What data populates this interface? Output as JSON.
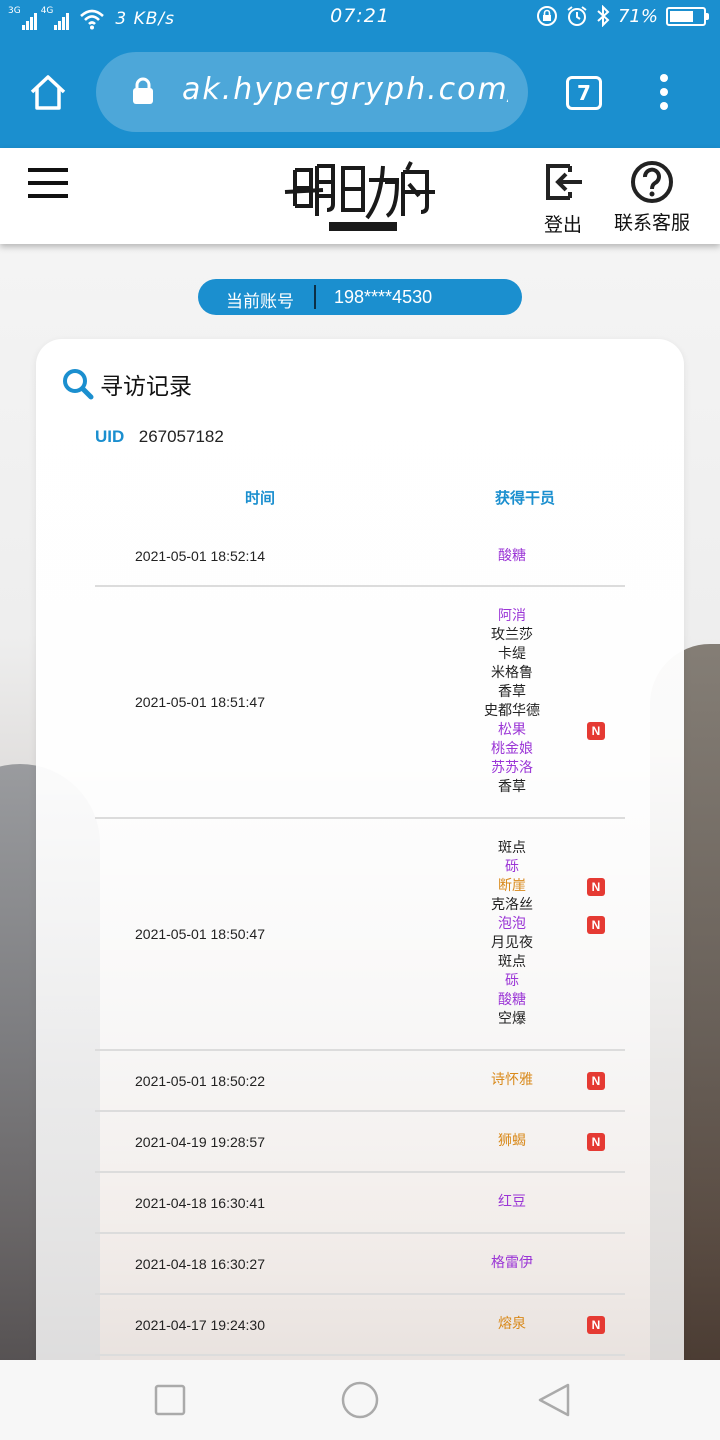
{
  "status_bar": {
    "net1": "3G",
    "net2": "4G",
    "speed": "3 KB/s",
    "time": "07:21",
    "battery": "71%",
    "battery_level": 0.71
  },
  "browser": {
    "url": "ak.hypergryph.com/us",
    "tab_count": "7"
  },
  "header": {
    "logout_label": "登出",
    "help_label": "联系客服"
  },
  "account": {
    "label": "当前账号",
    "value": "198****4530"
  },
  "card": {
    "title": "寻访记录",
    "uid_label": "UID",
    "uid_value": "267057182",
    "col_time": "时间",
    "col_operator": "获得干员",
    "new_badge": "N"
  },
  "records": [
    {
      "time": "2021-05-01 18:52:14",
      "ops": [
        {
          "name": "酸糖",
          "rarity": 4,
          "new": false
        }
      ]
    },
    {
      "time": "2021-05-01 18:51:47",
      "ops": [
        {
          "name": "阿消",
          "rarity": 4,
          "new": false
        },
        {
          "name": "玫兰莎",
          "rarity": 3,
          "new": false
        },
        {
          "name": "卡缇",
          "rarity": 3,
          "new": false
        },
        {
          "name": "米格鲁",
          "rarity": 3,
          "new": false
        },
        {
          "name": "香草",
          "rarity": 3,
          "new": false
        },
        {
          "name": "史都华德",
          "rarity": 3,
          "new": false
        },
        {
          "name": "松果",
          "rarity": 4,
          "new": true
        },
        {
          "name": "桃金娘",
          "rarity": 4,
          "new": false
        },
        {
          "name": "苏苏洛",
          "rarity": 4,
          "new": false
        },
        {
          "name": "香草",
          "rarity": 3,
          "new": false
        }
      ]
    },
    {
      "time": "2021-05-01 18:50:47",
      "ops": [
        {
          "name": "斑点",
          "rarity": 3,
          "new": false
        },
        {
          "name": "砾",
          "rarity": 4,
          "new": false
        },
        {
          "name": "断崖",
          "rarity": 5,
          "new": true
        },
        {
          "name": "克洛丝",
          "rarity": 3,
          "new": false
        },
        {
          "name": "泡泡",
          "rarity": 4,
          "new": true
        },
        {
          "name": "月见夜",
          "rarity": 3,
          "new": false
        },
        {
          "name": "斑点",
          "rarity": 3,
          "new": false
        },
        {
          "name": "砾",
          "rarity": 4,
          "new": false
        },
        {
          "name": "酸糖",
          "rarity": 4,
          "new": false
        },
        {
          "name": "空爆",
          "rarity": 3,
          "new": false
        }
      ]
    },
    {
      "time": "2021-05-01 18:50:22",
      "ops": [
        {
          "name": "诗怀雅",
          "rarity": 5,
          "new": true
        }
      ]
    },
    {
      "time": "2021-04-19 19:28:57",
      "ops": [
        {
          "name": "狮蝎",
          "rarity": 5,
          "new": true
        }
      ]
    },
    {
      "time": "2021-04-18 16:30:41",
      "ops": [
        {
          "name": "红豆",
          "rarity": 4,
          "new": false
        }
      ]
    },
    {
      "time": "2021-04-18 16:30:27",
      "ops": [
        {
          "name": "格雷伊",
          "rarity": 4,
          "new": false
        }
      ]
    },
    {
      "time": "2021-04-17 19:24:30",
      "ops": [
        {
          "name": "熔泉",
          "rarity": 5,
          "new": true
        }
      ]
    }
  ],
  "colors": {
    "accent": "#1b8fcf",
    "rarity3": "#222222",
    "rarity4": "#9b36d6",
    "rarity5": "#d98a1c",
    "badge": "#e53a33"
  }
}
